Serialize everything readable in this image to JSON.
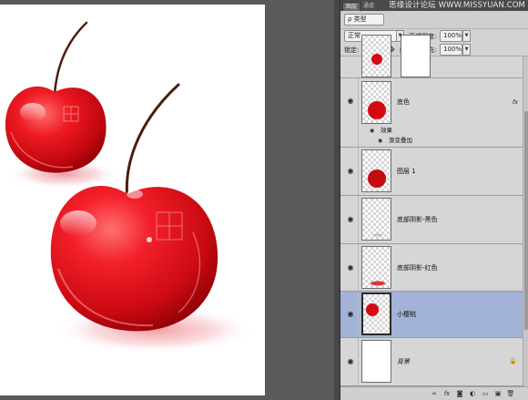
{
  "panel": {
    "tabs": [
      "图层",
      "通道"
    ],
    "watermark": "思缘设计论坛 WWW.MISSYUAN.COM",
    "filter": {
      "label": "ρ 类型"
    },
    "blend_mode": "正常",
    "opacity_label": "不透明度:",
    "opacity_value": "100%",
    "lock_label": "锁定:",
    "fill_label": "填充:",
    "fill_value": "100%"
  },
  "layers": [
    {
      "name": "底色",
      "fx": "fx",
      "sub": [
        {
          "label": "效果"
        },
        {
          "label": "渐变叠加"
        }
      ]
    },
    {
      "name": "图层 1"
    },
    {
      "name": "底部阴影-黑色"
    },
    {
      "name": "底部阴影-红色"
    },
    {
      "name": "小樱桃",
      "selected": true
    },
    {
      "name": "背景",
      "locked": true
    }
  ],
  "icons": {
    "eye": "eye-icon",
    "lock": "lock-icon",
    "footer": [
      "link-icon",
      "fx-icon",
      "mask-icon",
      "adjustment-icon",
      "folder-icon",
      "new-layer-icon",
      "trash-icon"
    ]
  },
  "colors": {
    "cherry_red": "#d40a12",
    "selected_layer": "#a3b3d8",
    "panel_bg": "#d6d6d6",
    "workspace": "#5a5a5a"
  }
}
